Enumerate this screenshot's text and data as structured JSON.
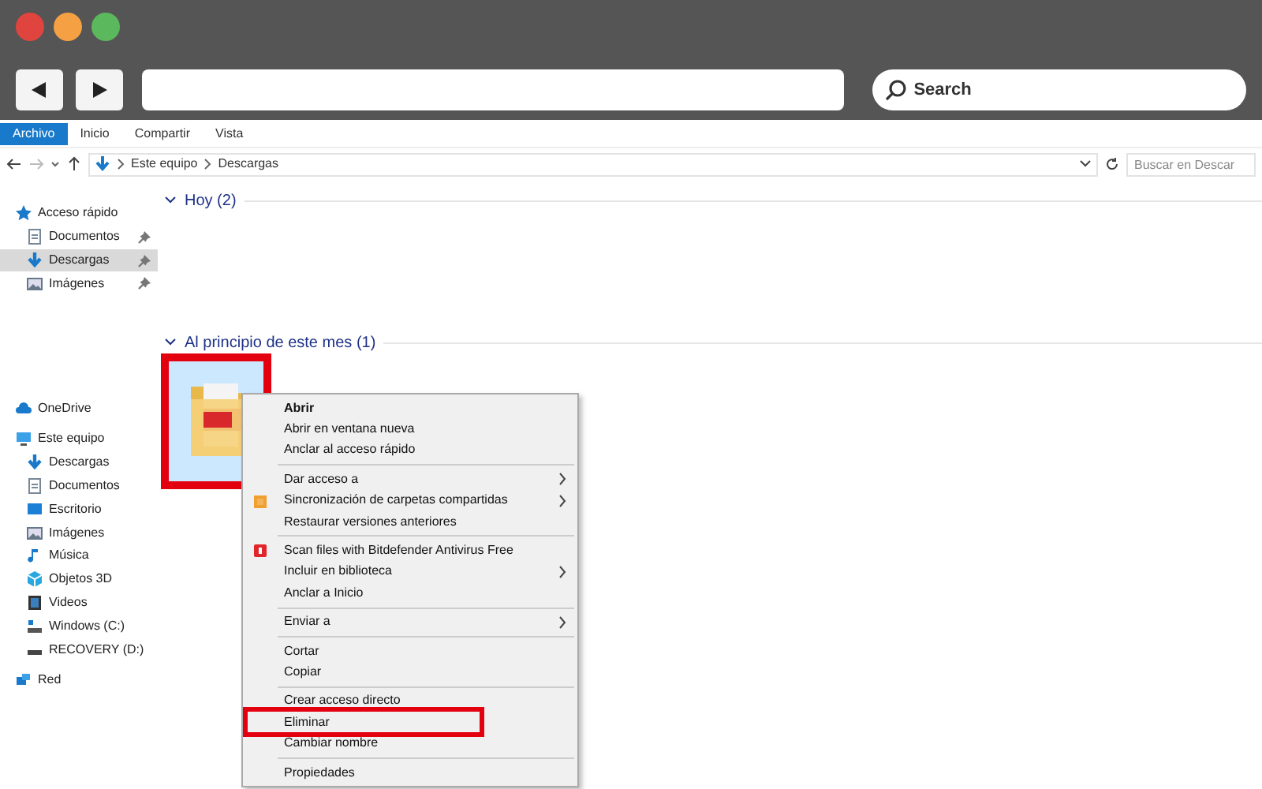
{
  "browser": {
    "search_placeholder": "Search"
  },
  "ribbon_tabs": [
    {
      "label": "Archivo",
      "selected": true
    },
    {
      "label": "Inicio",
      "selected": false
    },
    {
      "label": "Compartir",
      "selected": false
    },
    {
      "label": "Vista",
      "selected": false
    }
  ],
  "address": {
    "path": [
      "Este equipo",
      "Descargas"
    ],
    "search_placeholder": "Buscar en Descar"
  },
  "sidebar": [
    {
      "label": "Acceso rápido",
      "kind": "star",
      "selected": false,
      "children": [
        {
          "label": "Documentos",
          "kind": "doc",
          "selected": false,
          "pinned": true
        },
        {
          "label": "Descargas",
          "kind": "down",
          "selected": true,
          "pinned": true
        },
        {
          "label": "Imágenes",
          "kind": "image",
          "selected": false,
          "pinned": true
        }
      ]
    },
    {
      "label": "OneDrive",
      "kind": "cloud",
      "selected": false
    },
    {
      "label": "Este equipo",
      "kind": "pc",
      "selected": false,
      "children": [
        {
          "label": "Descargas",
          "kind": "down",
          "selected": false
        },
        {
          "label": "Documentos",
          "kind": "doc",
          "selected": false
        },
        {
          "label": "Escritorio",
          "kind": "desk",
          "selected": false
        },
        {
          "label": "Imágenes",
          "kind": "image",
          "selected": false
        },
        {
          "label": "Música",
          "kind": "music",
          "selected": false
        },
        {
          "label": "Objetos 3D",
          "kind": "cube",
          "selected": false
        },
        {
          "label": "Videos",
          "kind": "video",
          "selected": false
        },
        {
          "label": "Windows (C:)",
          "kind": "drive",
          "selected": false
        },
        {
          "label": "RECOVERY (D:)",
          "kind": "disk",
          "selected": false
        }
      ]
    },
    {
      "label": "Red",
      "kind": "net",
      "selected": false
    }
  ],
  "groups": [
    {
      "label": "Hoy (2)"
    },
    {
      "label": "Al principio de este mes (1)",
      "files": [
        {
          "kind": "pdf-folder",
          "selected": true,
          "highlighted": true
        }
      ]
    }
  ],
  "context_menu": [
    [
      {
        "label": "Abrir",
        "kind": "plain",
        "bold": true,
        "submenu": false,
        "highlighted": false
      },
      {
        "label": "Abrir en ventana nueva",
        "kind": "plain",
        "bold": false,
        "submenu": false,
        "highlighted": false
      },
      {
        "label": "Anclar al acceso rápido",
        "kind": "plain",
        "bold": false,
        "submenu": false,
        "highlighted": false
      }
    ],
    [
      {
        "label": "Dar acceso a",
        "kind": "plain",
        "bold": false,
        "submenu": true,
        "highlighted": false
      },
      {
        "label": "Sincronización de carpetas compartidas",
        "kind": "sync",
        "bold": false,
        "submenu": true,
        "highlighted": false
      },
      {
        "label": "Restaurar versiones anteriores",
        "kind": "plain",
        "bold": false,
        "submenu": false,
        "highlighted": false
      }
    ],
    [
      {
        "label": "Scan files with Bitdefender Antivirus Free",
        "kind": "shield",
        "bold": false,
        "submenu": false,
        "highlighted": false
      },
      {
        "label": "Incluir en biblioteca",
        "kind": "plain",
        "bold": false,
        "submenu": true,
        "highlighted": false
      },
      {
        "label": "Anclar a Inicio",
        "kind": "plain",
        "bold": false,
        "submenu": false,
        "highlighted": false
      }
    ],
    [
      {
        "label": "Enviar a",
        "kind": "plain",
        "bold": false,
        "submenu": true,
        "highlighted": false
      }
    ],
    [
      {
        "label": "Cortar",
        "kind": "plain",
        "bold": false,
        "submenu": false,
        "highlighted": false
      },
      {
        "label": "Copiar",
        "kind": "plain",
        "bold": false,
        "submenu": false,
        "highlighted": false
      }
    ],
    [
      {
        "label": "Crear acceso directo",
        "kind": "plain",
        "bold": false,
        "submenu": false,
        "highlighted": false
      },
      {
        "label": "Eliminar",
        "kind": "plain",
        "bold": false,
        "submenu": false,
        "highlighted": true
      },
      {
        "label": "Cambiar nombre",
        "kind": "plain",
        "bold": false,
        "submenu": false,
        "highlighted": false
      }
    ],
    [
      {
        "label": "Propiedades",
        "kind": "plain",
        "bold": false,
        "submenu": false,
        "highlighted": false
      }
    ]
  ]
}
